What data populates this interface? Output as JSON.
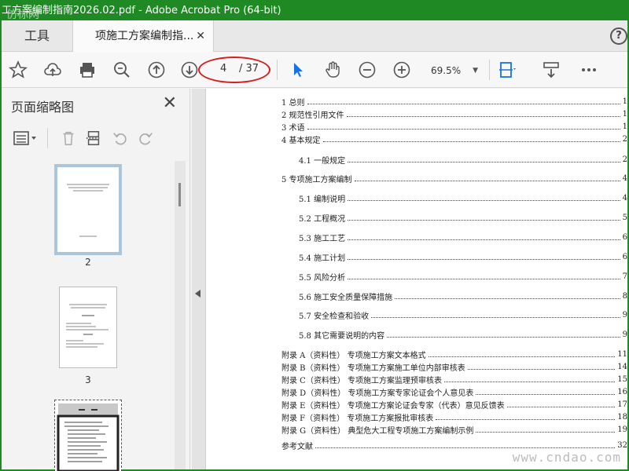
{
  "window": {
    "title": "工方案编制指南2026.02.pdf - Adobe Acrobat Pro (64-bit)"
  },
  "watermark_top": "仿标网",
  "tabs": {
    "tools_label": "工具",
    "doc_label": "项施工方案编制指...",
    "close": "✕"
  },
  "help": "?",
  "toolbar": {
    "current_page": "4",
    "total_pages": "/ 37",
    "zoom": "69.5%"
  },
  "sidebar": {
    "title": "页面缩略图",
    "close": "✕",
    "thumbnails": [
      {
        "label": "2"
      },
      {
        "label": "3"
      },
      {
        "label": ""
      }
    ]
  },
  "toc": [
    {
      "title": "1 总则",
      "page": "1",
      "sub": false
    },
    {
      "title": "2 规范性引用文件",
      "page": "1",
      "sub": false
    },
    {
      "title": "3 术语",
      "page": "1",
      "sub": false
    },
    {
      "title": "4 基本规定",
      "page": "2",
      "sub": false
    },
    {
      "title": "4.1  一般规定",
      "page": "2",
      "sub": true
    },
    {
      "title": "5 专项施工方案编制",
      "page": "4",
      "sub": false
    },
    {
      "title": "5.1 编制说明",
      "page": "4",
      "sub": true
    },
    {
      "title": "5.2 工程概况",
      "page": "5",
      "sub": true
    },
    {
      "title": "5.3 施工工艺",
      "page": "6",
      "sub": true
    },
    {
      "title": "5.4 施工计划",
      "page": "6",
      "sub": true
    },
    {
      "title": "5.5 风险分析",
      "page": "7",
      "sub": true
    },
    {
      "title": "5.6 施工安全质量保障措施",
      "page": "8",
      "sub": true
    },
    {
      "title": "5.7 安全检查和验收",
      "page": "9",
      "sub": true
    },
    {
      "title": "5.8 其它需要说明的内容",
      "page": "9",
      "sub": true
    },
    {
      "title": "附录 A（资料性）  专项施工方案文本格式",
      "page": "11",
      "sub": false
    },
    {
      "title": "附录 B（资料性）  专项施工方案施工单位内部审核表",
      "page": "14",
      "sub": false
    },
    {
      "title": "附录 C（资料性）  专项施工方案监理预审核表",
      "page": "15",
      "sub": false
    },
    {
      "title": "附录 D（资料性）  专项施工方案专家论证会个人意见表",
      "page": "16",
      "sub": false
    },
    {
      "title": "附录 E（资料性）  专项施工方案论证会专家（代表）意见反馈表",
      "page": "17",
      "sub": false
    },
    {
      "title": "附录 F（资料性）  专项施工方案报批审核表",
      "page": "18",
      "sub": false
    },
    {
      "title": "附录 G（资料性）  典型危大工程专项施工方案编制示例",
      "page": "19",
      "sub": false
    },
    {
      "title": "参考文献",
      "page": "32",
      "sub": false
    }
  ],
  "footer_watermark": "www.cndao.com"
}
